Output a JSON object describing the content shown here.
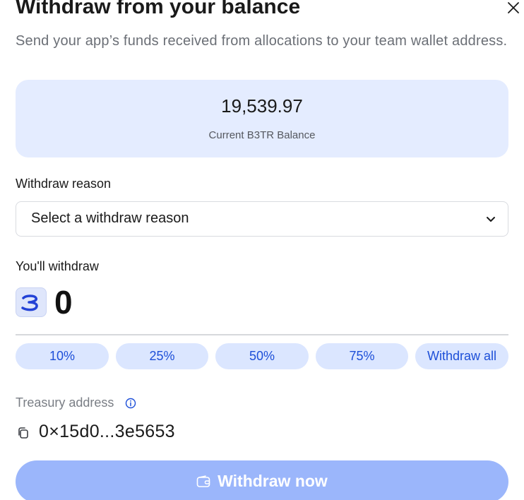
{
  "dialog": {
    "title": "Withdraw from your balance",
    "subtitle": "Send your app’s funds received from allocations to your team wallet address.",
    "close_icon": "close-icon"
  },
  "balance": {
    "value": "19,539.97",
    "label": "Current B3TR Balance"
  },
  "reason": {
    "label": "Withdraw reason",
    "placeholder": "Select a withdraw reason",
    "icon": "chevron-down-icon"
  },
  "amount": {
    "label": "You'll withdraw",
    "value": "0",
    "token_icon": "b3tr-token-icon"
  },
  "presets": [
    {
      "label": "10%"
    },
    {
      "label": "25%"
    },
    {
      "label": "50%"
    },
    {
      "label": "75%"
    },
    {
      "label": "Withdraw all"
    }
  ],
  "treasury": {
    "label": "Treasury address",
    "info_icon": "info-icon",
    "copy_icon": "copy-icon",
    "address": "0×15d0...3e5653"
  },
  "submit": {
    "label": "Withdraw now",
    "icon": "wallet-icon"
  },
  "colors": {
    "accent": "#1d4fd8",
    "card_bg": "#e4ecff",
    "chip_bg": "#dbe6ff",
    "button_disabled": "#9bb6fb"
  }
}
